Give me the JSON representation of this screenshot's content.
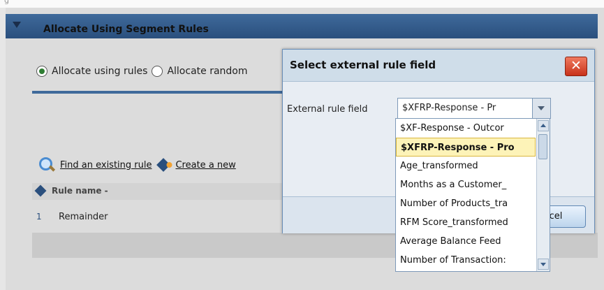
{
  "top_strip": {
    "text": "g"
  },
  "panel": {
    "title": "Allocate Using Segment Rules"
  },
  "allocation": {
    "option_rules": "Allocate using rules",
    "option_random": "Allocate random"
  },
  "toolbar": {
    "find_label": "Find an existing rule",
    "create_label": "Create a new"
  },
  "table": {
    "header_label": "Rule name -",
    "rows": [
      {
        "index": "1",
        "name": "Remainder"
      }
    ]
  },
  "dialog": {
    "title": "Select external rule field",
    "close_label": "✕",
    "field_label": "External rule field",
    "selected_value": "$XFRP-Response - Pr",
    "cancel_label": "cel",
    "options": [
      "$XF-Response - Outcor",
      "$XFRP-Response - Pro",
      "Age_transformed",
      "Months as a Customer_",
      "Number of Products_tra",
      "RFM Score_transformed",
      "Average Balance Feed",
      "Number of Transaction:"
    ]
  }
}
